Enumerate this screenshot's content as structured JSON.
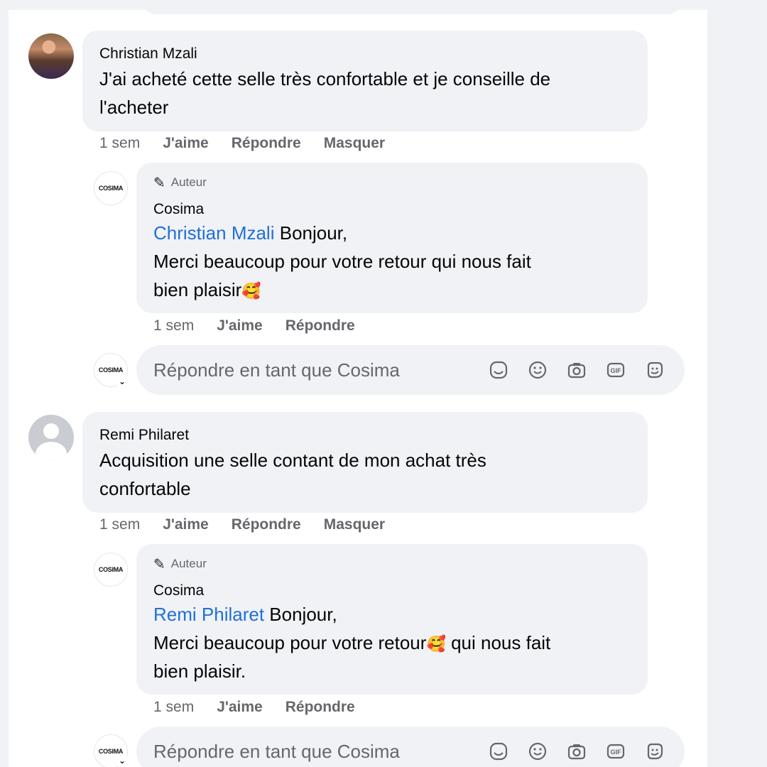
{
  "comments": [
    {
      "author": "Christian Mzali",
      "text_line1": "J'ai acheté cette selle très confortable et je conseille de",
      "text_line2": "l'acheter",
      "time": "1 sem",
      "like": "J'aime",
      "reply": "Répondre",
      "hide": "Masquer",
      "avatar_icon": "user-photo",
      "response": {
        "badge": "Auteur",
        "author": "Cosima",
        "avatar_label": "COSIMA",
        "mention": "Christian Mzali",
        "line1_rest": " Bonjour,",
        "line2": "Merci beaucoup pour votre retour qui nous fait",
        "line3": "bien plaisir",
        "emoji": "🥰",
        "time": "1 sem",
        "like": "J'aime",
        "reply": "Répondre"
      }
    },
    {
      "author": "Remi Philaret",
      "text_line1": "Acquisition une selle contant de mon achat très",
      "text_line2": "confortable",
      "time": "1 sem",
      "like": "J'aime",
      "reply": "Répondre",
      "hide": "Masquer",
      "avatar_icon": "default-user-icon",
      "response": {
        "badge": "Auteur",
        "author": "Cosima",
        "avatar_label": "COSIMA",
        "mention": "Remi Philaret",
        "line1_rest": " Bonjour,",
        "line2_a": "Merci beaucoup pour votre retour",
        "emoji": "🥰",
        "line2_b": " qui nous fait",
        "line3": "bien plaisir.",
        "time": "1 sem",
        "like": "J'aime",
        "reply": "Répondre"
      }
    }
  ],
  "reply_box": {
    "placeholder": "Répondre en tant que Cosima",
    "avatar_label": "COSIMA",
    "icons": [
      "avatar-sticker-icon",
      "emoji-icon",
      "camera-icon",
      "gif-icon",
      "sticker-icon"
    ],
    "gif_label": "GIF"
  },
  "colors": {
    "bubble": "#f0f2f5",
    "mention": "#216fdb",
    "muted": "#65676b"
  }
}
